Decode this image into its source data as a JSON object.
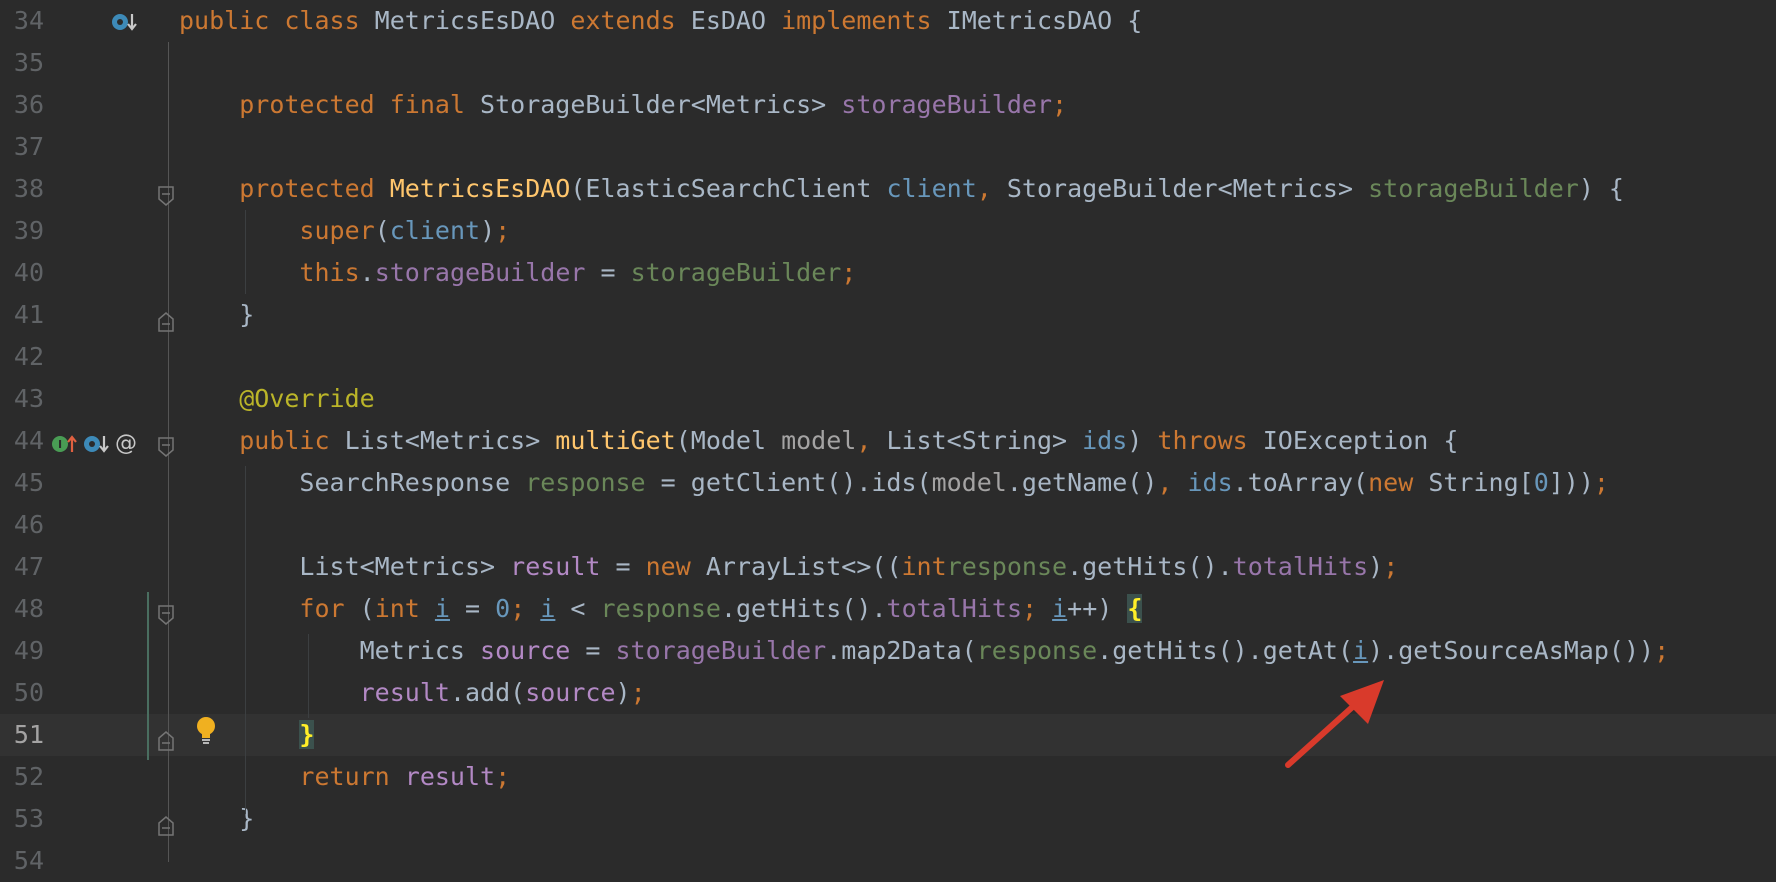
{
  "lines": [
    {
      "num": "34",
      "parts": [
        [
          "k",
          "public class "
        ],
        [
          "",
          "MetricsEsDAO "
        ],
        [
          "k",
          "extends "
        ],
        [
          "",
          "EsDAO "
        ],
        [
          "k",
          "implements "
        ],
        [
          "",
          "IMetricsDAO {"
        ]
      ]
    },
    {
      "num": "35",
      "parts": []
    },
    {
      "num": "36",
      "parts": [
        [
          "",
          "    "
        ],
        [
          "k",
          "protected final "
        ],
        [
          "",
          "StorageBuilder<Metrics> "
        ],
        [
          "p",
          "storageBuilder"
        ],
        [
          "k",
          ";"
        ]
      ]
    },
    {
      "num": "37",
      "parts": []
    },
    {
      "num": "38",
      "parts": [
        [
          "",
          "    "
        ],
        [
          "k",
          "protected "
        ],
        [
          "m",
          "MetricsEsDAO"
        ],
        [
          "",
          "(ElasticSearchClient "
        ],
        [
          "pr",
          "client"
        ],
        [
          "k",
          ", "
        ],
        [
          "",
          "StorageBuilder<Metrics> "
        ],
        [
          "l",
          "storageBuilder"
        ],
        [
          "",
          ") {"
        ]
      ]
    },
    {
      "num": "39",
      "parts": [
        [
          "",
          "        "
        ],
        [
          "k",
          "super"
        ],
        [
          "",
          "("
        ],
        [
          "pr",
          "client"
        ],
        [
          "",
          ")"
        ],
        [
          "k",
          ";"
        ]
      ]
    },
    {
      "num": "40",
      "parts": [
        [
          "",
          "        "
        ],
        [
          "k",
          "this"
        ],
        [
          "",
          "."
        ],
        [
          "p",
          "storageBuilder"
        ],
        [
          "",
          " = "
        ],
        [
          "l",
          "storageBuilder"
        ],
        [
          "k",
          ";"
        ]
      ]
    },
    {
      "num": "41",
      "parts": [
        [
          "",
          "    }"
        ]
      ]
    },
    {
      "num": "42",
      "parts": []
    },
    {
      "num": "43",
      "parts": [
        [
          "",
          "    "
        ],
        [
          "a",
          "@Override"
        ]
      ]
    },
    {
      "num": "44",
      "parts": [
        [
          "",
          "    "
        ],
        [
          "k",
          "public "
        ],
        [
          "",
          "List<Metrics> "
        ],
        [
          "m",
          "multiGet"
        ],
        [
          "",
          "(Model "
        ],
        [
          "g",
          "model"
        ],
        [
          "k",
          ", "
        ],
        [
          "",
          "List<String> "
        ],
        [
          "n",
          "ids"
        ],
        [
          ") ",
          ") "
        ],
        [
          "k",
          "throws "
        ],
        [
          "",
          "IOException {"
        ]
      ]
    },
    {
      "num": "45",
      "parts": [
        [
          "",
          "        SearchResponse "
        ],
        [
          "l",
          "response"
        ],
        [
          "",
          " = getClient().ids("
        ],
        [
          "g",
          "model"
        ],
        [
          "",
          ".getName()"
        ],
        [
          "k",
          ", "
        ],
        [
          "n",
          "ids"
        ],
        [
          "",
          ".toArray("
        ],
        [
          "k",
          "new "
        ],
        [
          "",
          "String["
        ],
        [
          "n",
          "0"
        ],
        [
          "",
          "]))"
        ],
        [
          "k",
          ";"
        ]
      ]
    },
    {
      "num": "46",
      "parts": []
    },
    {
      "num": "47",
      "parts": [
        [
          "",
          "        List<Metrics> "
        ],
        [
          "v",
          "result"
        ],
        [
          "",
          " = "
        ],
        [
          "k",
          "new "
        ],
        [
          "",
          "ArrayList<>(("
        ],
        [
          "k",
          "int"
        ],
        [
          ") "
        ],
        [
          "l",
          "response"
        ],
        [
          "",
          ".getHits()."
        ],
        [
          "p",
          "totalHits"
        ],
        [
          "",
          ")"
        ],
        [
          "k",
          ";"
        ]
      ]
    },
    {
      "num": "48",
      "parts": [
        [
          "",
          "        "
        ],
        [
          "k",
          "for "
        ],
        [
          "",
          "("
        ],
        [
          "k",
          "int "
        ],
        [
          "u",
          "i"
        ],
        [
          "",
          " = "
        ],
        [
          "n",
          "0"
        ],
        [
          "k",
          "; "
        ],
        [
          "u",
          "i"
        ],
        [
          "",
          " < "
        ],
        [
          "l",
          "response"
        ],
        [
          "",
          ".getHits()."
        ],
        [
          "p",
          "totalHits"
        ],
        [
          "k",
          "; "
        ],
        [
          "u",
          "i"
        ],
        [
          "",
          "++) "
        ],
        [
          "br",
          "{"
        ]
      ]
    },
    {
      "num": "49",
      "parts": [
        [
          "",
          "            Metrics "
        ],
        [
          "v",
          "source"
        ],
        [
          "",
          " = "
        ],
        [
          "p",
          "storageBuilder"
        ],
        [
          "",
          ".map2Data("
        ],
        [
          "l",
          "response"
        ],
        [
          "",
          ".getHits().getAt("
        ],
        [
          "u",
          "i"
        ],
        [
          "",
          ").getSourceAsMap())"
        ],
        [
          "k",
          ";"
        ]
      ]
    },
    {
      "num": "50",
      "parts": [
        [
          "",
          "            "
        ],
        [
          "v",
          "result"
        ],
        [
          "",
          ".add("
        ],
        [
          "v",
          "source"
        ],
        [
          "",
          ")"
        ],
        [
          "k",
          ";"
        ]
      ]
    },
    {
      "num": "51",
      "parts": [
        [
          "",
          "        "
        ],
        [
          "br",
          "}"
        ]
      ]
    },
    {
      "num": "52",
      "parts": [
        [
          "",
          "        "
        ],
        [
          "k",
          "return "
        ],
        [
          "v",
          "result"
        ],
        [
          "k",
          ";"
        ]
      ]
    },
    {
      "num": "53",
      "parts": [
        [
          "",
          "    }"
        ]
      ]
    },
    {
      "num": "54",
      "parts": []
    }
  ],
  "current_line": "51",
  "gutter_icons": {
    "line34": [
      "overrides-icon"
    ],
    "line44": [
      "implements-up-icon",
      "overrides-icon",
      "annotation-icon"
    ],
    "line51": [
      "intention-bulb-icon"
    ]
  },
  "colors": {
    "keyword": "#cc7832",
    "field": "#9876aa",
    "local": "#6a8759",
    "method_decl": "#ffc66d",
    "annotation": "#bbb529",
    "background": "#2b2b2b",
    "gutter": "#313335",
    "arrow": "#d93a2b"
  }
}
